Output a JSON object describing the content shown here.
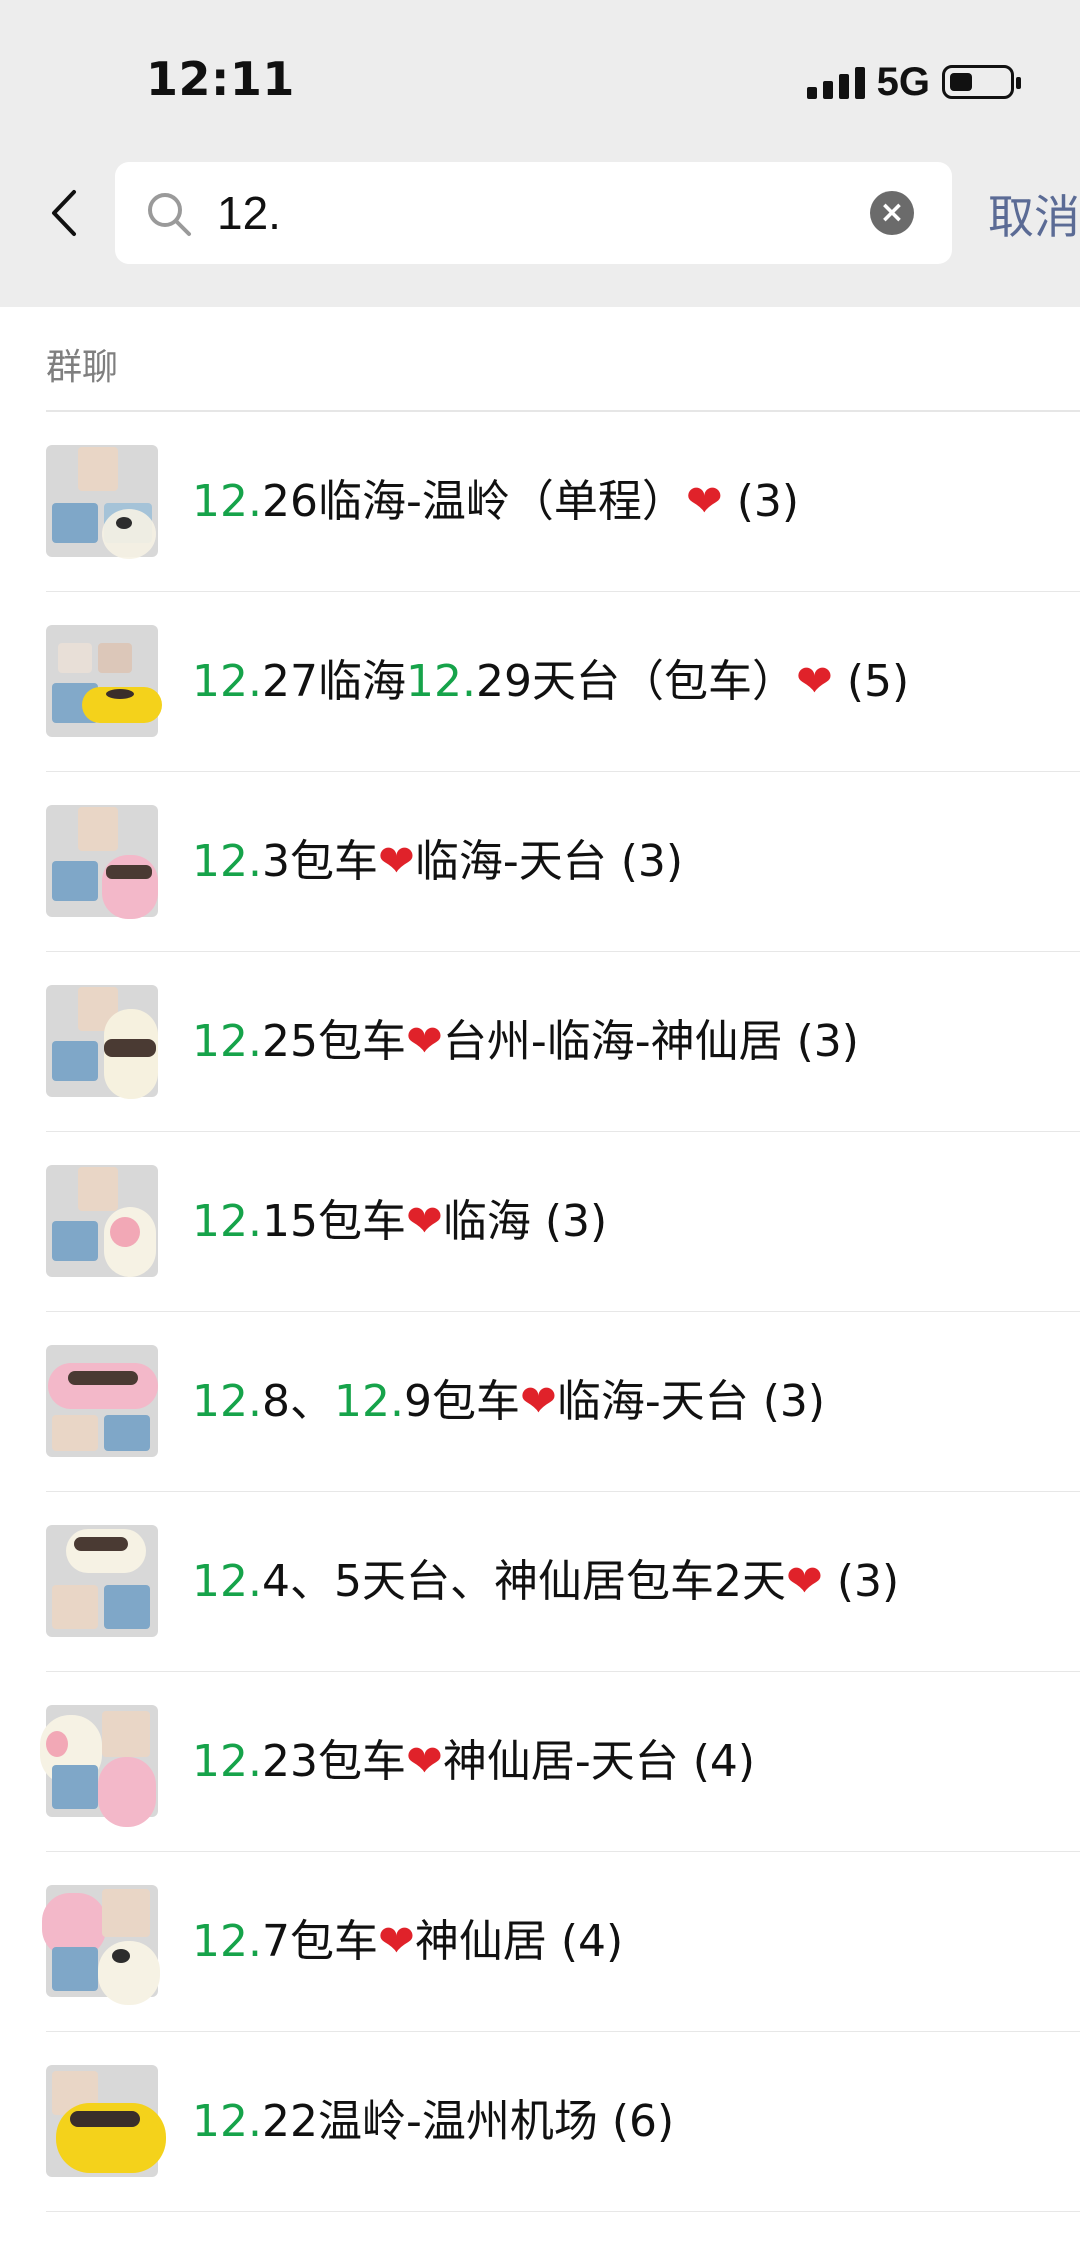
{
  "status": {
    "time": "12:11",
    "network": "5G"
  },
  "search": {
    "query": "12.",
    "cancel": "取消"
  },
  "section": {
    "title": "群聊"
  },
  "rows": [
    {
      "highlight": "12.",
      "text": "26临海-温岭（单程）",
      "suffix": " (3)"
    },
    {
      "highlight": "12.",
      "text": "27临海",
      "highlight2": "12.",
      "text2": "29天台（包车）",
      "suffix": " (5)"
    },
    {
      "highlight": "12.",
      "text": "3包车",
      "text_after_heart": "临海-天台",
      "suffix": " (3)"
    },
    {
      "highlight": "12.",
      "text": "25包车",
      "text_after_heart": "台州-临海-神仙居",
      "suffix": " (3)"
    },
    {
      "highlight": "12.",
      "text": "15包车",
      "text_after_heart": "临海",
      "suffix": " (3)"
    },
    {
      "highlight": "12.",
      "text": "8、",
      "highlight2": "12.",
      "text2": "9包车",
      "text_after_heart": "临海-天台",
      "suffix": " (3)"
    },
    {
      "highlight": "12.",
      "text": "4、5天台、神仙居包车2天",
      "suffix": " (3)"
    },
    {
      "highlight": "12.",
      "text": "23包车",
      "text_after_heart": "神仙居-天台",
      "suffix": " (4)"
    },
    {
      "highlight": "12.",
      "text": "7包车",
      "text_after_heart": "神仙居",
      "suffix": " (4)"
    },
    {
      "highlight": "12.",
      "text": "22温岭-温州机场",
      "suffix": " (6)"
    }
  ],
  "icons": {
    "back": "chevron-left-icon",
    "search": "search-icon",
    "clear": "clear-icon",
    "heart": "heart-icon"
  },
  "colors": {
    "highlight": "#16a34a",
    "heart": "#e0222a",
    "cancel": "#5b6b95"
  }
}
